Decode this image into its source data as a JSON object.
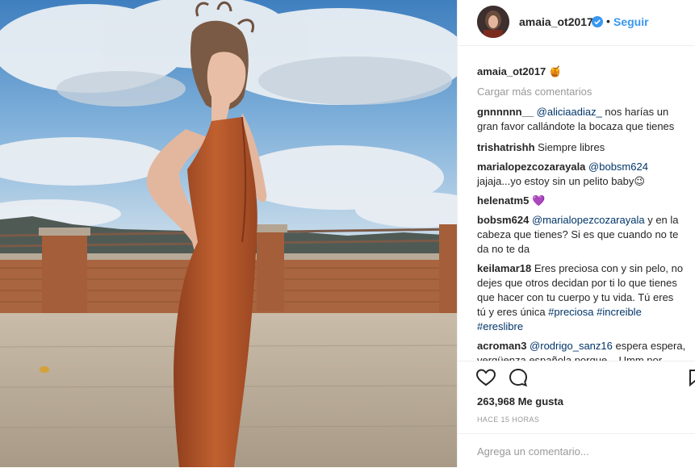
{
  "header": {
    "username": "amaia_ot2017",
    "follow_label": "Seguir",
    "separator": "•"
  },
  "caption": {
    "username": "amaia_ot2017",
    "emoji": "🍯"
  },
  "load_more": "Cargar más comentarios",
  "comments": [
    {
      "user": "gnnnnnn__",
      "lines": [
        [
          "@aliciaadiaz_",
          " nos harías un"
        ],
        [
          "",
          "gran favor callándote la bocaza que tienes"
        ]
      ]
    },
    {
      "user": "trishatrishh",
      "text": "Siempre libres"
    },
    {
      "user": "marialopezcozarayala",
      "mention": "@bobsm624",
      "text2": "jajaja...yo estoy sin un pelito baby😉"
    },
    {
      "user": "helenatm5",
      "emoji": "💜"
    },
    {
      "user": "bobsm624",
      "mention": "@marialopezcozarayala",
      "rest1": " y en la",
      "line2": "cabeza que tienes? Si es que cuando no te",
      "line3": "da no te da"
    },
    {
      "user": "keilamar18",
      "rest1": " Eres preciosa con y sin pelo, no",
      "line2": "dejes que otros decidan por ti lo que tienes",
      "line3": "que hacer con tu cuerpo y tu vida. Tú eres",
      "line4a": "tú y eres única ",
      "tag1": "#preciosa",
      "tag2": "#increible",
      "tag3": "#ereslibre"
    },
    {
      "user": "acroman3",
      "mention": "@rodrigo_sanz16",
      "rest1": " espera espera,",
      "line2": "vergüenza española porque... Umm por"
    }
  ],
  "likes": "263,968 Me gusta",
  "timestamp": "HACE 15 HORAS",
  "add_comment_placeholder": "Agrega un comentario...",
  "icons": [
    "heart-icon",
    "comment-icon",
    "save-icon",
    "verified-icon"
  ],
  "colors": {
    "link": "#3897f0",
    "mention": "#003569",
    "muted": "#999999",
    "dress": "#b85a2e"
  }
}
